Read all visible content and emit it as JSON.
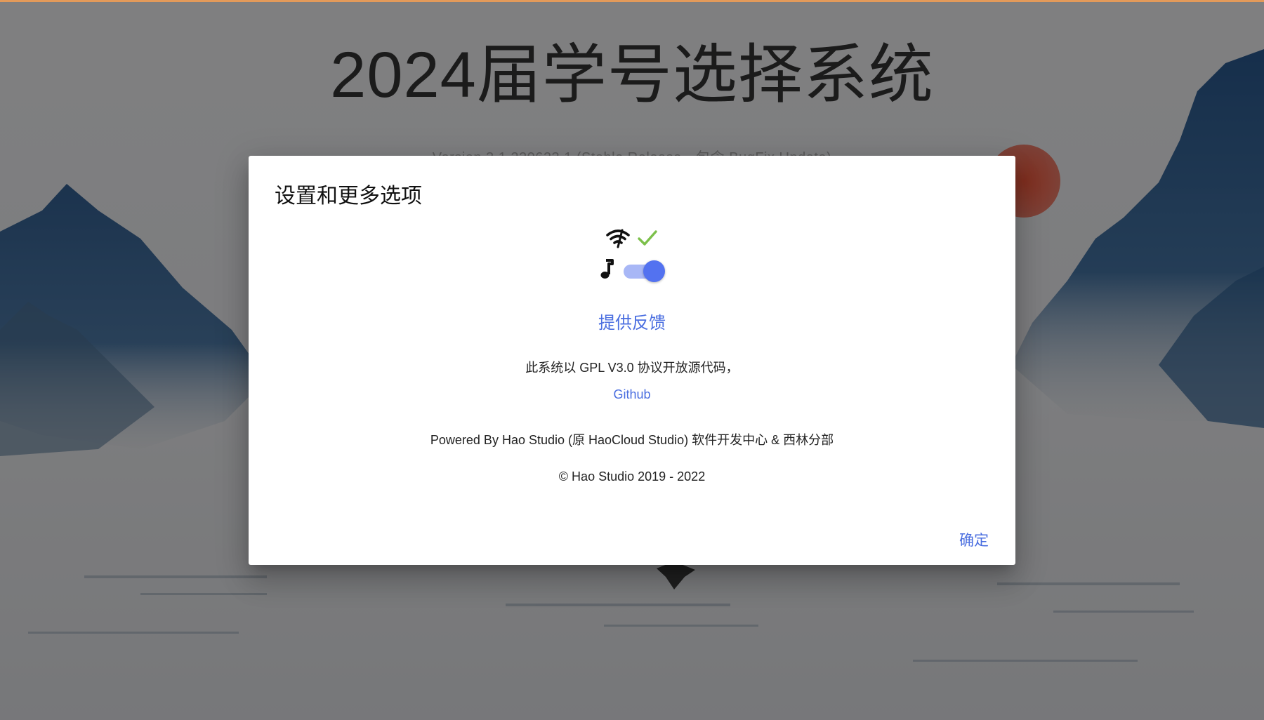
{
  "page": {
    "title": "2024届学号选择系统",
    "version": "Version 3.1.220623.1 (Stable Release，包含 BugFix Update)"
  },
  "dialog": {
    "title": "设置和更多选项",
    "icons": {
      "network": "wifi-icon",
      "status": "check-icon",
      "music": "music-note-icon"
    },
    "music_toggle_on": true,
    "feedback_label": "提供反馈",
    "license_text": "此系统以 GPL V3.0 协议开放源代码，",
    "github_label": "Github",
    "powered_text": "Powered By Hao Studio (原 HaoCloud Studio) 软件开发中心 & 西林分部",
    "copyright_text": "© Hao Studio 2019 - 2022",
    "confirm_label": "确定"
  },
  "colors": {
    "accent": "#4a6ee0",
    "toggle_thumb": "#5372f0",
    "toggle_track": "#a8b7f6",
    "check": "#7cc04a",
    "top_bar": "#e39a5a"
  }
}
